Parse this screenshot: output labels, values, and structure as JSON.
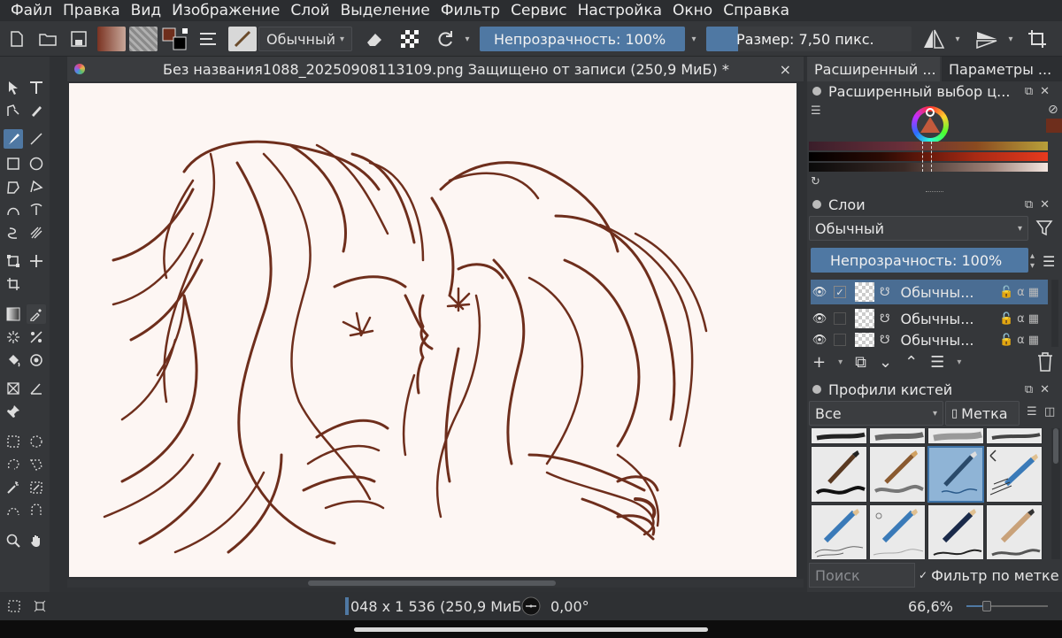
{
  "menu": [
    "Файл",
    "Правка",
    "Вид",
    "Изображение",
    "Слой",
    "Выделение",
    "Фильтр",
    "Сервис",
    "Настройка",
    "Окно",
    "Справка"
  ],
  "toolbar": {
    "blend_mode": "Обычный",
    "opacity": "Непрозрачность: 100%",
    "size": "Размер: 7,50 пикс."
  },
  "document": {
    "title": "Без названия1088_20250908113109.png Защищено от записи (250,9 МиБ) *",
    "close": "×"
  },
  "dock_tabs": [
    "Расширенный ...",
    "Параметры ..."
  ],
  "color_panel": {
    "title": "Расширенный выбор ц..."
  },
  "layers_panel": {
    "title": "Слои",
    "blend_mode": "Обычный",
    "opacity": "Непрозрачность:  100%",
    "layers": [
      {
        "name": "Обычны...",
        "selected": true,
        "checked": true
      },
      {
        "name": "Обычны...",
        "selected": false,
        "checked": false
      },
      {
        "name": "Обычны...",
        "selected": false,
        "checked": false
      }
    ]
  },
  "brush_panel": {
    "title": "Профили кистей",
    "filter_all": "Все",
    "tag_button": "Метка",
    "search_placeholder": "Поиск",
    "filter_by_tag": "Фильтр по метке"
  },
  "statusbar": {
    "image_size": "048 x 1 536 (250,9 МиБ",
    "rotation": "0,00°",
    "zoom": "66,6%"
  },
  "colors": {
    "stroke": "#6e2e1c",
    "canvas_bg": "#fdf6f3",
    "accent": "#4f78a3",
    "foreground_color": "#6e2e1c"
  }
}
